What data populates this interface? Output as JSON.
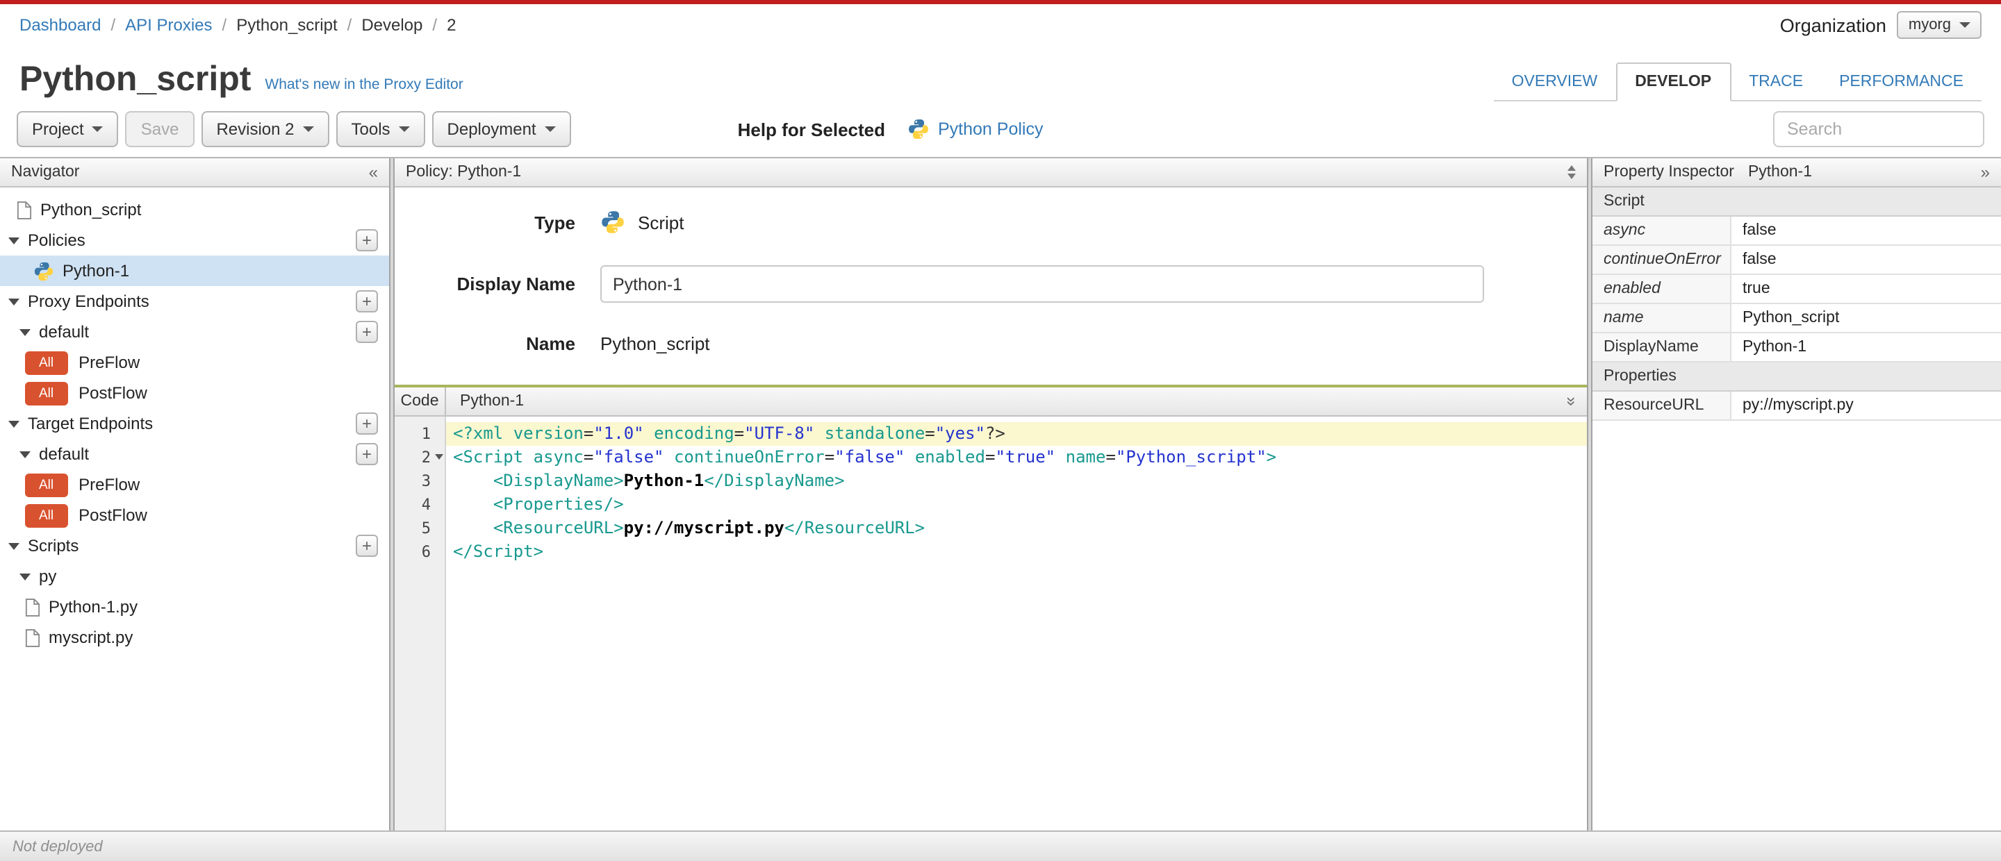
{
  "colors": {
    "top_bar": "#c11e1e",
    "link": "#337ab7",
    "selected_row": "#cfe2f4",
    "badge": "#d9522f",
    "code_tag": "#18998f",
    "code_string": "#2433cf",
    "active_line": "#fbf7cf"
  },
  "breadcrumb": {
    "separator": "/",
    "items": [
      {
        "label": "Dashboard",
        "link": true
      },
      {
        "label": "API Proxies",
        "link": true
      },
      {
        "label": "Python_script",
        "link": false
      },
      {
        "label": "Develop",
        "link": false
      },
      {
        "label": "2",
        "link": false
      }
    ]
  },
  "organization": {
    "label": "Organization",
    "value": "myorg"
  },
  "page": {
    "title": "Python_script",
    "whats_new_link": "What's new in the Proxy Editor"
  },
  "tabs": [
    {
      "label": "OVERVIEW",
      "active": false
    },
    {
      "label": "DEVELOP",
      "active": true
    },
    {
      "label": "TRACE",
      "active": false
    },
    {
      "label": "PERFORMANCE",
      "active": false
    }
  ],
  "toolbar": {
    "project_button": "Project",
    "save_button": "Save",
    "revision_button": "Revision 2",
    "tools_button": "Tools",
    "deployment_button": "Deployment",
    "help_for_selected_label": "Help for Selected",
    "policy_help_link": "Python Policy",
    "search_placeholder": "Search"
  },
  "navigator": {
    "title": "Navigator",
    "collapse_icon": "«",
    "items": [
      {
        "label": "Python_script",
        "level": 0,
        "icon": "proxy"
      },
      {
        "label": "Policies",
        "level": 0,
        "group": true,
        "expanded": true,
        "plus": true
      },
      {
        "label": "Python-1",
        "level": 1,
        "icon": "python",
        "selected": true
      },
      {
        "label": "Proxy Endpoints",
        "level": 0,
        "group": true,
        "expanded": true,
        "plus": true
      },
      {
        "label": "default",
        "level": 1,
        "group": true,
        "expanded": true,
        "plus": true
      },
      {
        "label": "PreFlow",
        "level": 2,
        "badge": "All"
      },
      {
        "label": "PostFlow",
        "level": 2,
        "badge": "All"
      },
      {
        "label": "Target Endpoints",
        "level": 0,
        "group": true,
        "expanded": true,
        "plus": true
      },
      {
        "label": "default",
        "level": 1,
        "group": true,
        "expanded": true,
        "plus": true
      },
      {
        "label": "PreFlow",
        "level": 2,
        "badge": "All"
      },
      {
        "label": "PostFlow",
        "level": 2,
        "badge": "All"
      },
      {
        "label": "Scripts",
        "level": 0,
        "group": true,
        "expanded": true,
        "plus": true
      },
      {
        "label": "py",
        "level": 1,
        "group": true,
        "expanded": true
      },
      {
        "label": "Python-1.py",
        "level": 2,
        "icon": "file"
      },
      {
        "label": "myscript.py",
        "level": 2,
        "icon": "file"
      }
    ]
  },
  "policy_panel": {
    "title": "Policy: Python-1",
    "type_label": "Type",
    "type_value": "Script",
    "display_name_label": "Display Name",
    "display_name_value": "Python-1",
    "name_label": "Name",
    "name_value": "Python_script"
  },
  "code_panel": {
    "tab_label": "Code",
    "title": "Python-1",
    "active_line": 1,
    "fold_line": 2,
    "lines": [
      {
        "no": 1,
        "tokens": [
          [
            "tag",
            "<?xml"
          ],
          [
            "ws",
            " "
          ],
          [
            "attr",
            "version"
          ],
          [
            "eq",
            "="
          ],
          [
            "str",
            "\"1.0\""
          ],
          [
            "ws",
            " "
          ],
          [
            "attr",
            "encoding"
          ],
          [
            "eq",
            "="
          ],
          [
            "str",
            "\"UTF-8\""
          ],
          [
            "ws",
            " "
          ],
          [
            "attr",
            "standalone"
          ],
          [
            "eq",
            "="
          ],
          [
            "str",
            "\"yes\""
          ],
          [
            "punc",
            "?>"
          ]
        ]
      },
      {
        "no": 2,
        "tokens": [
          [
            "tag",
            "<Script"
          ],
          [
            "ws",
            " "
          ],
          [
            "attr",
            "async"
          ],
          [
            "eq",
            "="
          ],
          [
            "str",
            "\"false\""
          ],
          [
            "ws",
            " "
          ],
          [
            "attr",
            "continueOnError"
          ],
          [
            "eq",
            "="
          ],
          [
            "str",
            "\"false\""
          ],
          [
            "ws",
            " "
          ],
          [
            "attr",
            "enabled"
          ],
          [
            "eq",
            "="
          ],
          [
            "str",
            "\"true\""
          ],
          [
            "ws",
            " "
          ],
          [
            "attr",
            "name"
          ],
          [
            "eq",
            "="
          ],
          [
            "str",
            "\"Python_script\""
          ],
          [
            "tag",
            ">"
          ]
        ]
      },
      {
        "no": 3,
        "tokens": [
          [
            "ws",
            "    "
          ],
          [
            "tag",
            "<DisplayName>"
          ],
          [
            "text",
            "Python-1"
          ],
          [
            "tag",
            "</DisplayName>"
          ]
        ]
      },
      {
        "no": 4,
        "tokens": [
          [
            "ws",
            "    "
          ],
          [
            "tag",
            "<Properties/>"
          ]
        ]
      },
      {
        "no": 5,
        "tokens": [
          [
            "ws",
            "    "
          ],
          [
            "tag",
            "<ResourceURL>"
          ],
          [
            "text",
            "py://myscript.py"
          ],
          [
            "tag",
            "</ResourceURL>"
          ]
        ]
      },
      {
        "no": 6,
        "tokens": [
          [
            "tag",
            "</Script>"
          ]
        ]
      }
    ]
  },
  "inspector": {
    "title": "Property Inspector",
    "subtitle": "Python-1",
    "expand_icon": "»",
    "rows": [
      {
        "type": "section",
        "label": "Script"
      },
      {
        "type": "attr",
        "label": "async",
        "value": "false"
      },
      {
        "type": "attr",
        "label": "continueOnError",
        "value": "false"
      },
      {
        "type": "attr",
        "label": "enabled",
        "value": "true"
      },
      {
        "type": "attr",
        "label": "name",
        "value": "Python_script"
      },
      {
        "type": "element",
        "label": "DisplayName",
        "value": "Python-1"
      },
      {
        "type": "section",
        "label": "Properties"
      },
      {
        "type": "element",
        "label": "ResourceURL",
        "value": "py://myscript.py"
      }
    ]
  },
  "status_bar": {
    "text": "Not deployed"
  }
}
